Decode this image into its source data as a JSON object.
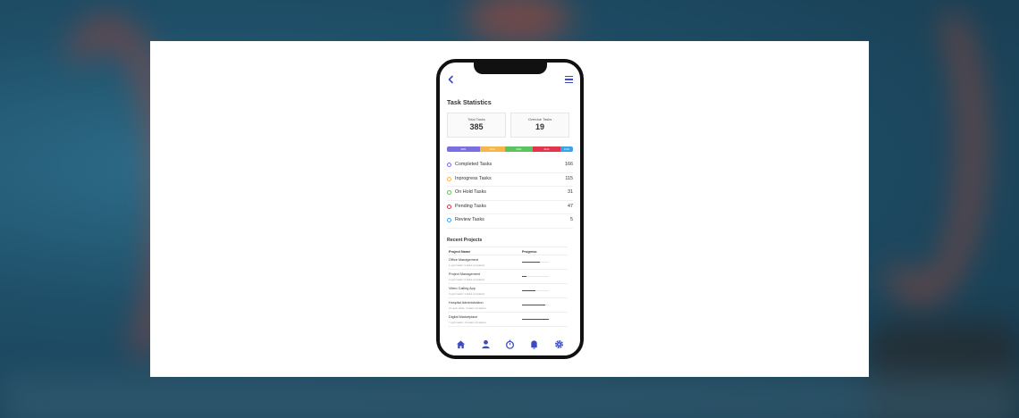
{
  "app": {
    "title": "Task Statistics",
    "accent": "#3c4ac4"
  },
  "stats": [
    {
      "label": "Total Tasks",
      "value": "385"
    },
    {
      "label": "Overdue Tasks",
      "value": "19"
    }
  ],
  "progress_segments": [
    {
      "label": "30%",
      "percent": 26,
      "color": "#7a6fe0"
    },
    {
      "label": "22%",
      "percent": 20,
      "color": "#f7b54a"
    },
    {
      "label": "24%",
      "percent": 22,
      "color": "#5cc45f"
    },
    {
      "label": "21%",
      "percent": 22,
      "color": "#e2344d"
    },
    {
      "label": "10%",
      "percent": 10,
      "color": "#3aa3e8"
    }
  ],
  "tasks": [
    {
      "name": "Completed Tasks",
      "count": "166",
      "color": "#7a6fe0"
    },
    {
      "name": "Inprogress Tasks",
      "count": "115",
      "color": "#f7b54a"
    },
    {
      "name": "On Hold Tasks",
      "count": "31",
      "color": "#5cc45f"
    },
    {
      "name": "Pending Tasks",
      "count": "47",
      "color": "#e2344d"
    },
    {
      "name": "Review Tasks",
      "count": "5",
      "color": "#3aa3e8"
    }
  ],
  "recent_projects": {
    "title": "Recent Projects",
    "headers": {
      "name": "Project Name",
      "progress": "Progress"
    },
    "rows": [
      {
        "name": "Office Management",
        "sub": "1 open tasks, 9 tasks completed",
        "progress": 65
      },
      {
        "name": "Project Management",
        "sub": "2 open tasks, 5 tasks completed",
        "progress": 15
      },
      {
        "name": "Video Calling App",
        "sub": "3 open tasks, 3 tasks completed",
        "progress": 50
      },
      {
        "name": "Hospital Administration",
        "sub": "12 open tasks, 4 tasks completed",
        "progress": 88
      },
      {
        "name": "Digital Marketplace",
        "sub": "7 open tasks, 14 tasks completed",
        "progress": 100
      }
    ]
  },
  "nav": [
    "home-icon",
    "user-icon",
    "timer-icon",
    "bell-icon",
    "gear-icon"
  ]
}
